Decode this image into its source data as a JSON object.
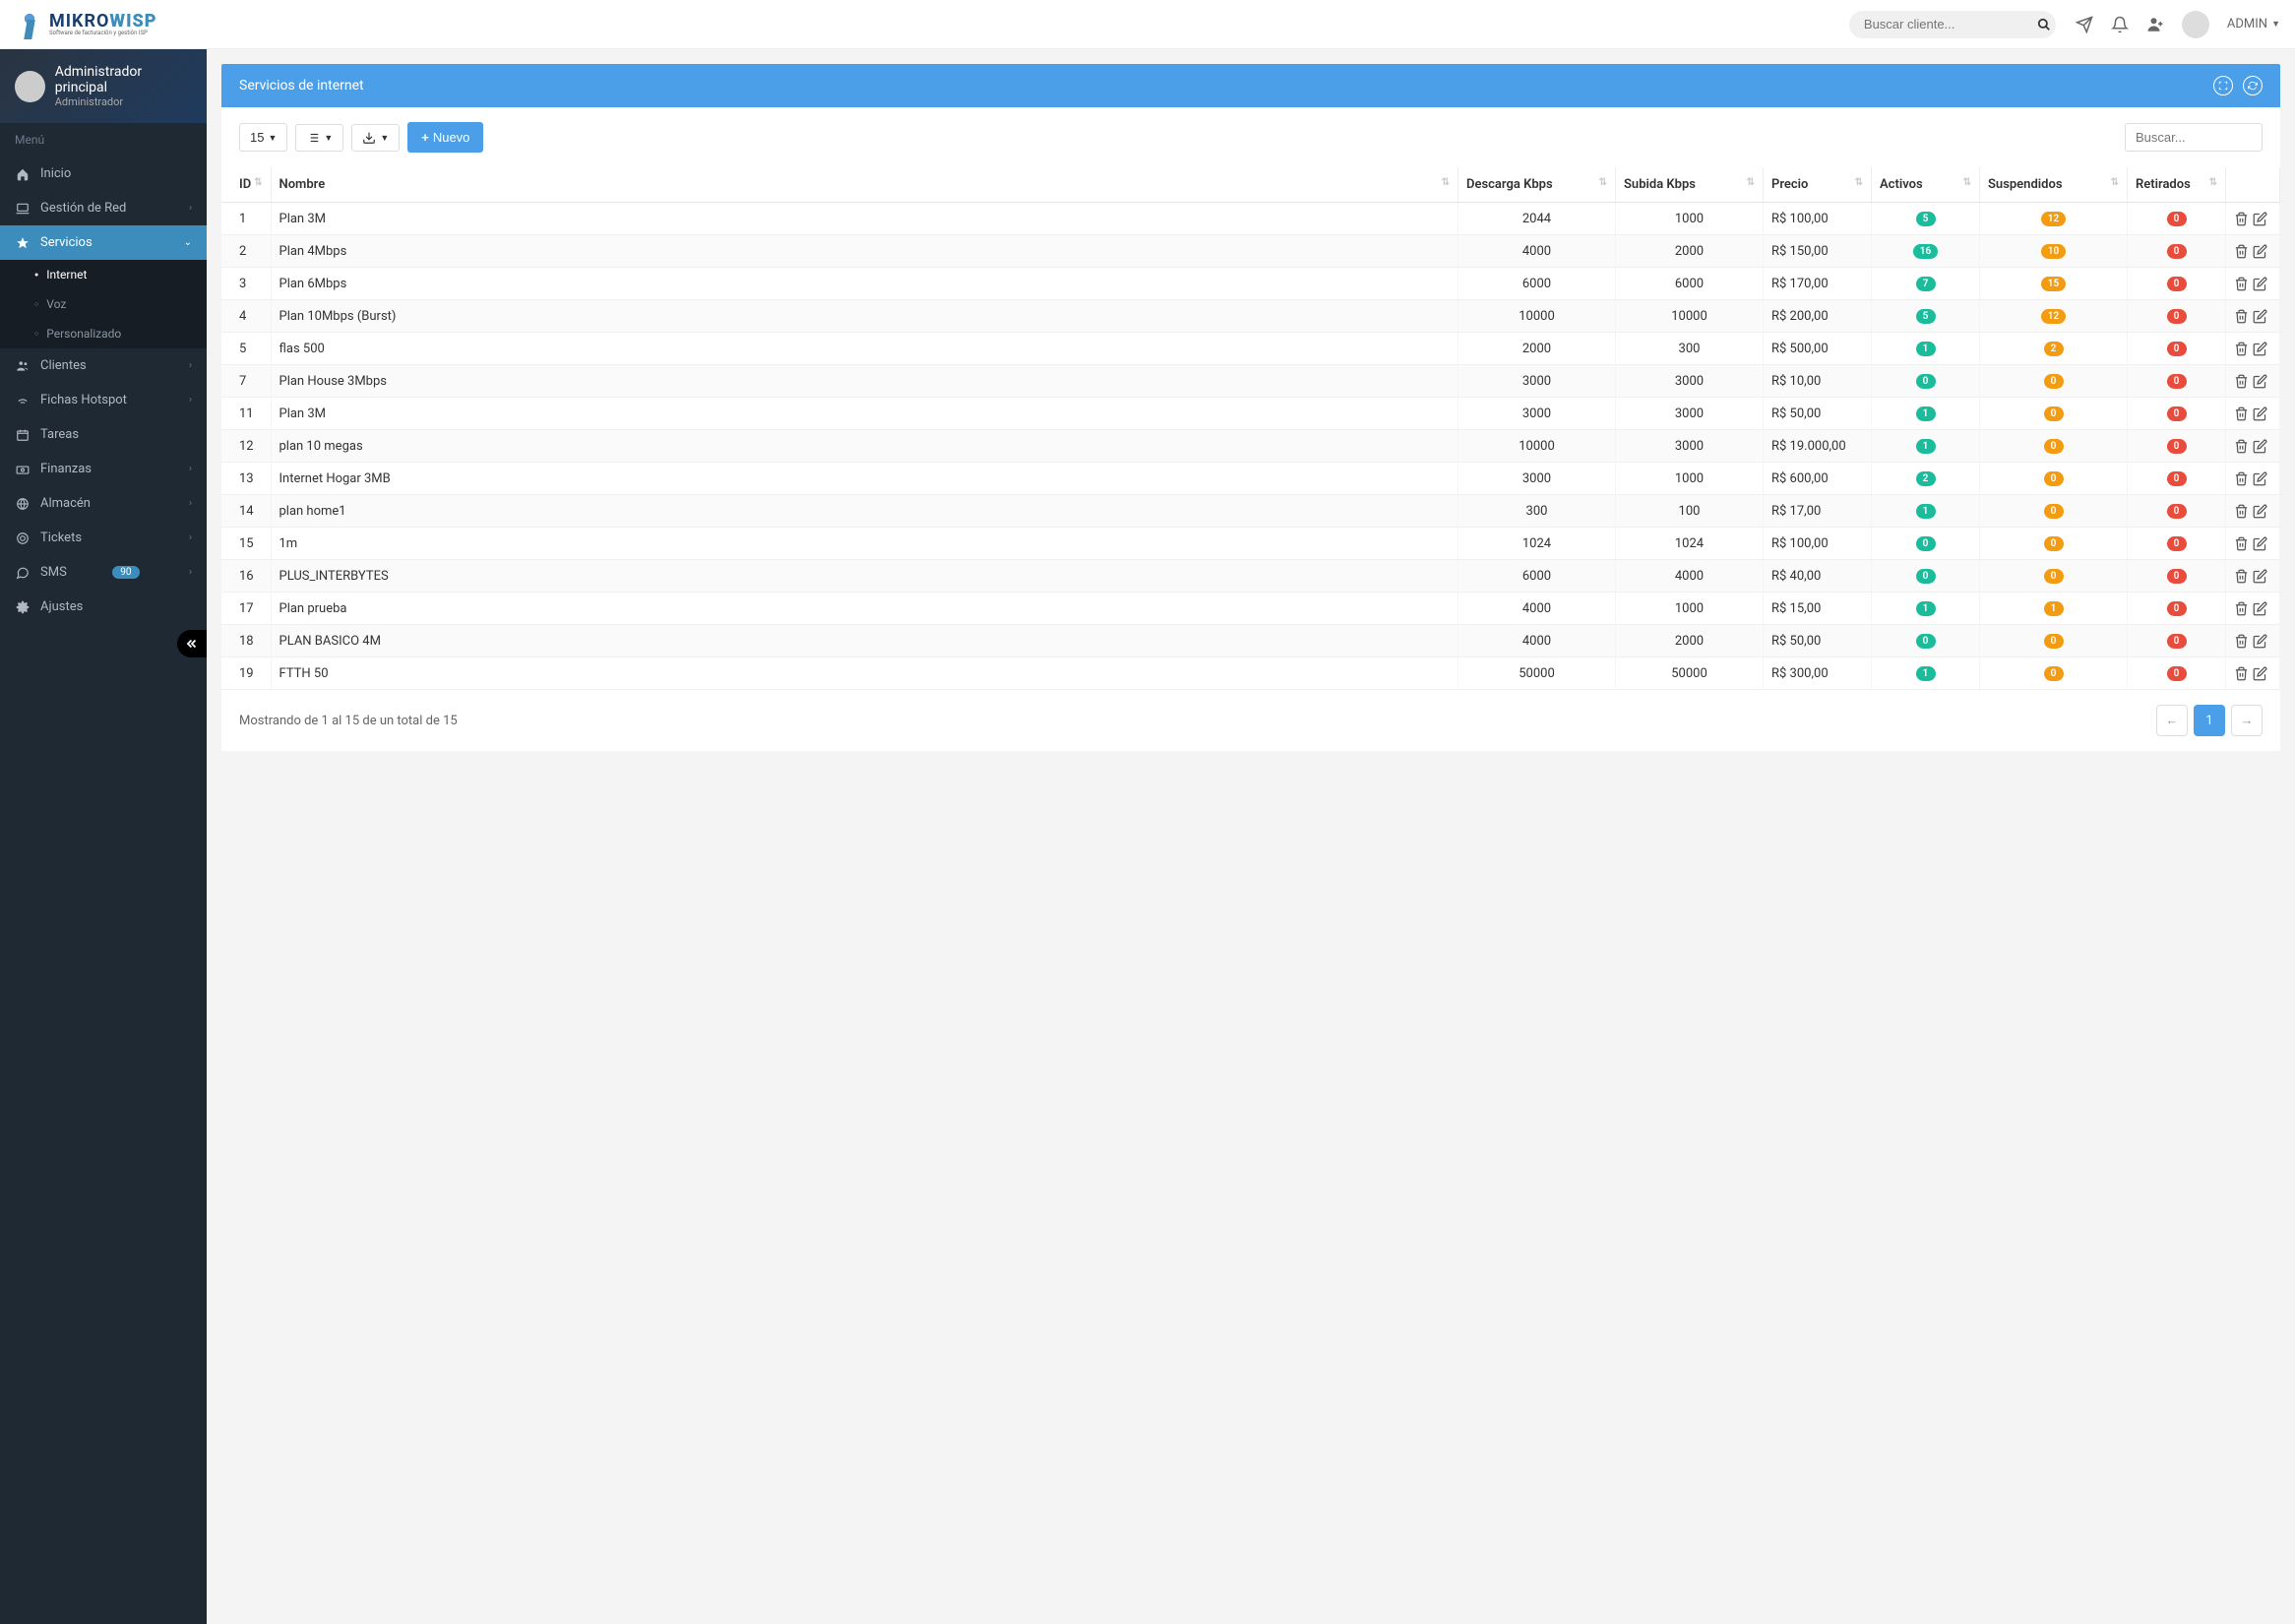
{
  "header": {
    "brand_main": "MIKROWISP",
    "brand_sub": "Software de facturación y gestión ISP",
    "search_placeholder": "Buscar cliente...",
    "admin_label": "ADMIN"
  },
  "sidebar": {
    "user_name": "Administrador principal",
    "user_role": "Administrador",
    "menu_label": "Menú",
    "items": [
      {
        "label": "Inicio",
        "icon": "home"
      },
      {
        "label": "Gestión de Red",
        "icon": "laptop",
        "expandable": true
      },
      {
        "label": "Servicios",
        "icon": "star",
        "expandable": true,
        "active": true
      },
      {
        "label": "Clientes",
        "icon": "users",
        "expandable": true
      },
      {
        "label": "Fichas Hotspot",
        "icon": "wifi",
        "expandable": true
      },
      {
        "label": "Tareas",
        "icon": "calendar"
      },
      {
        "label": "Finanzas",
        "icon": "money",
        "expandable": true
      },
      {
        "label": "Almacén",
        "icon": "globe",
        "expandable": true
      },
      {
        "label": "Tickets",
        "icon": "ticket",
        "expandable": true
      },
      {
        "label": "SMS",
        "icon": "sms",
        "badge": "90",
        "expandable": true
      },
      {
        "label": "Ajustes",
        "icon": "cog"
      }
    ],
    "submenu": [
      {
        "label": "Internet",
        "active": true
      },
      {
        "label": "Voz"
      },
      {
        "label": "Personalizado"
      }
    ]
  },
  "panel": {
    "title": "Servicios de internet",
    "page_size": "15",
    "new_button": "Nuevo",
    "filter_placeholder": "Buscar..."
  },
  "table": {
    "columns": [
      "ID",
      "Nombre",
      "Descarga Kbps",
      "Subida Kbps",
      "Precio",
      "Activos",
      "Suspendidos",
      "Retirados",
      ""
    ],
    "rows": [
      {
        "id": "1",
        "nombre": "Plan 3M",
        "descarga": "2044",
        "subida": "1000",
        "precio": "R$ 100,00",
        "activos": "5",
        "susp": "12",
        "ret": "0"
      },
      {
        "id": "2",
        "nombre": "Plan 4Mbps",
        "descarga": "4000",
        "subida": "2000",
        "precio": "R$ 150,00",
        "activos": "16",
        "susp": "10",
        "ret": "0"
      },
      {
        "id": "3",
        "nombre": "Plan 6Mbps",
        "descarga": "6000",
        "subida": "6000",
        "precio": "R$ 170,00",
        "activos": "7",
        "susp": "15",
        "ret": "0"
      },
      {
        "id": "4",
        "nombre": "Plan 10Mbps (Burst)",
        "descarga": "10000",
        "subida": "10000",
        "precio": "R$ 200,00",
        "activos": "5",
        "susp": "12",
        "ret": "0"
      },
      {
        "id": "5",
        "nombre": "flas 500",
        "descarga": "2000",
        "subida": "300",
        "precio": "R$ 500,00",
        "activos": "1",
        "susp": "2",
        "ret": "0"
      },
      {
        "id": "7",
        "nombre": "Plan House 3Mbps",
        "descarga": "3000",
        "subida": "3000",
        "precio": "R$ 10,00",
        "activos": "0",
        "susp": "0",
        "ret": "0"
      },
      {
        "id": "11",
        "nombre": "Plan 3M",
        "descarga": "3000",
        "subida": "3000",
        "precio": "R$ 50,00",
        "activos": "1",
        "susp": "0",
        "ret": "0"
      },
      {
        "id": "12",
        "nombre": "plan 10 megas",
        "descarga": "10000",
        "subida": "3000",
        "precio": "R$ 19.000,00",
        "activos": "1",
        "susp": "0",
        "ret": "0"
      },
      {
        "id": "13",
        "nombre": "Internet Hogar 3MB",
        "descarga": "3000",
        "subida": "1000",
        "precio": "R$ 600,00",
        "activos": "2",
        "susp": "0",
        "ret": "0"
      },
      {
        "id": "14",
        "nombre": "plan home1",
        "descarga": "300",
        "subida": "100",
        "precio": "R$ 17,00",
        "activos": "1",
        "susp": "0",
        "ret": "0"
      },
      {
        "id": "15",
        "nombre": "1m",
        "descarga": "1024",
        "subida": "1024",
        "precio": "R$ 100,00",
        "activos": "0",
        "susp": "0",
        "ret": "0"
      },
      {
        "id": "16",
        "nombre": "PLUS_INTERBYTES",
        "descarga": "6000",
        "subida": "4000",
        "precio": "R$ 40,00",
        "activos": "0",
        "susp": "0",
        "ret": "0"
      },
      {
        "id": "17",
        "nombre": "Plan prueba",
        "descarga": "4000",
        "subida": "1000",
        "precio": "R$ 15,00",
        "activos": "1",
        "susp": "1",
        "ret": "0"
      },
      {
        "id": "18",
        "nombre": "PLAN BASICO 4M",
        "descarga": "4000",
        "subida": "2000",
        "precio": "R$ 50,00",
        "activos": "0",
        "susp": "0",
        "ret": "0"
      },
      {
        "id": "19",
        "nombre": "FTTH 50",
        "descarga": "50000",
        "subida": "50000",
        "precio": "R$ 300,00",
        "activos": "1",
        "susp": "0",
        "ret": "0"
      }
    ],
    "footer": "Mostrando de 1 al 15 de un total de 15",
    "page": "1"
  }
}
